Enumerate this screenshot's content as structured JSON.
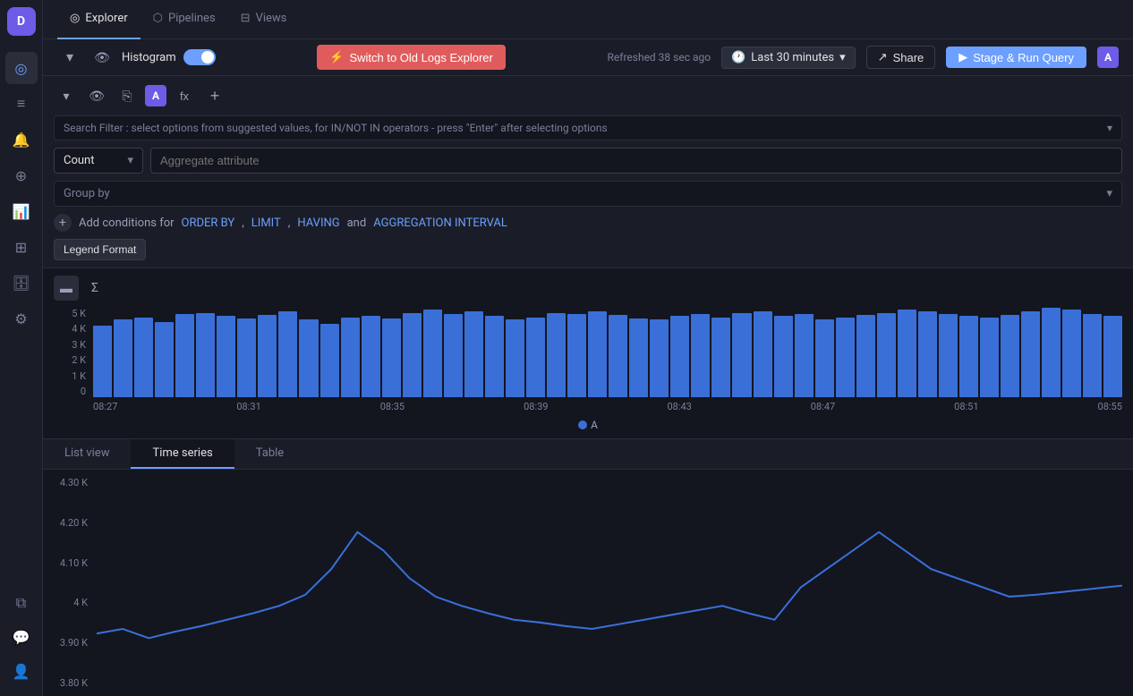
{
  "app": {
    "logo": "D"
  },
  "sidebar": {
    "icons": [
      {
        "name": "explorer-icon",
        "symbol": "◎",
        "active": true
      },
      {
        "name": "pipelines-icon",
        "symbol": "⬡",
        "active": false
      },
      {
        "name": "views-icon",
        "symbol": "⊟",
        "active": false
      },
      {
        "name": "logs-icon",
        "symbol": "≡",
        "active": false
      },
      {
        "name": "alerts-icon",
        "symbol": "🔔",
        "active": false
      },
      {
        "name": "groups-icon",
        "symbol": "⊕",
        "active": false
      },
      {
        "name": "chart-icon",
        "symbol": "📊",
        "active": false
      },
      {
        "name": "settings-icon",
        "symbol": "⚙",
        "active": false
      }
    ],
    "bottom_icons": [
      {
        "name": "layers-icon",
        "symbol": "⧉"
      },
      {
        "name": "chat-icon",
        "symbol": "💬"
      },
      {
        "name": "user-icon",
        "symbol": "👤"
      }
    ]
  },
  "nav": {
    "tabs": [
      {
        "label": "Explorer",
        "icon": "◎",
        "active": true
      },
      {
        "label": "Pipelines",
        "icon": "⬡",
        "active": false
      },
      {
        "label": "Views",
        "icon": "⊟",
        "active": false
      }
    ]
  },
  "toolbar": {
    "histogram_label": "Histogram",
    "toggle_on": true,
    "switch_btn_label": "Switch to Old Logs Explorer",
    "refresh_text": "Refreshed 38 sec ago",
    "clock_icon": "🕐",
    "time_range": "Last 30 minutes",
    "share_label": "Share",
    "share_icon": "↗",
    "run_icon": "▶",
    "run_label": "Stage & Run Query"
  },
  "query": {
    "search_placeholder": "Search Filter : select options from suggested values, for IN/NOT IN operators - press \"Enter\" after selecting options",
    "count_label": "Count",
    "aggregate_placeholder": "Aggregate attribute",
    "group_by_label": "Group by",
    "conditions_text": "Add conditions for",
    "order_by_link": "ORDER BY",
    "limit_link": "LIMIT",
    "having_link": "HAVING",
    "and_text": "and",
    "aggregation_link": "AGGREGATION INTERVAL",
    "legend_btn": "Legend Format"
  },
  "histogram": {
    "y_labels": [
      "5 K",
      "4 K",
      "3 K",
      "2 K",
      "1 K",
      "0"
    ],
    "x_labels": [
      "08:27",
      "08:31",
      "08:35",
      "08:39",
      "08:43",
      "08:47",
      "08:51",
      "08:55"
    ],
    "bars": [
      72,
      78,
      80,
      76,
      84,
      85,
      82,
      79,
      83,
      86,
      78,
      74,
      80,
      82,
      79,
      85,
      88,
      84,
      86,
      82,
      78,
      80,
      85,
      84,
      86,
      83,
      79,
      78,
      82,
      84,
      80,
      85,
      86,
      82,
      84,
      78,
      80,
      83,
      85,
      88,
      86,
      84,
      82,
      80,
      83,
      86,
      90,
      88,
      84,
      82
    ],
    "legend_label": "A"
  },
  "bottom_tabs": [
    {
      "label": "List view",
      "active": false
    },
    {
      "label": "Time series",
      "active": true
    },
    {
      "label": "Table",
      "active": false
    }
  ],
  "timeseries": {
    "y_labels": [
      "4.30 K",
      "4.20 K",
      "4.10 K",
      "4 K",
      "3.90 K",
      "3.80 K"
    ],
    "color": "#3a6fd8"
  }
}
